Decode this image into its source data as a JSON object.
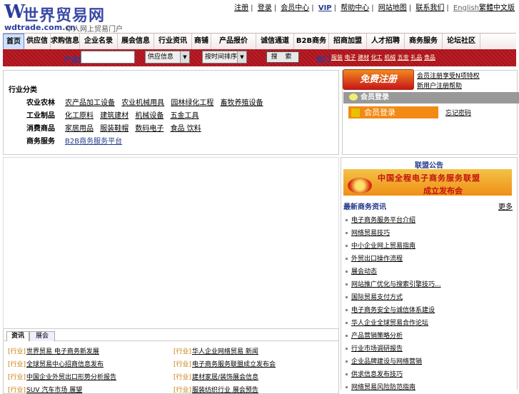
{
  "logo": {
    "mark": "W",
    "name": "世界贸易网",
    "url": "wdtrade.com.cn",
    "slogan": "华人网上贸易门户"
  },
  "toplinks": [
    "注册",
    "登录",
    "会员中心",
    "VIP",
    "帮助中心",
    "网站地图",
    "联系我们",
    "English",
    "繁體中文版"
  ],
  "nav": [
    "首页",
    "供应信息",
    "求购信息",
    "企业名录",
    "展会信息",
    "行业资讯",
    "商铺",
    "产品报价",
    "诚信通道",
    "B2B商务",
    "招商加盟",
    "人才招聘",
    "商务服务",
    "论坛社区"
  ],
  "search": {
    "label": "产品搜索",
    "value": "",
    "category": "供应信息",
    "sort": "按时间排序",
    "button": "搜 索",
    "hot_label": "热门",
    "hot_links": [
      "服装",
      "电子",
      "建材",
      "化工",
      "机械",
      "五金",
      "礼品",
      "食品"
    ]
  },
  "categories": {
    "title": "行业分类",
    "rows": [
      {
        "name": "农业农林",
        "links": [
          "农产品加工设备",
          "农业机械用具",
          "园林绿化工程",
          "畜牧养殖设备"
        ]
      },
      {
        "name": "工业制品",
        "links": [
          "化工原料",
          "建筑建材",
          "机械设备",
          "五金工具"
        ]
      },
      {
        "name": "消费商品",
        "links": [
          "家居用品",
          "服装鞋帽",
          "数码电子",
          "食品 饮料"
        ]
      },
      {
        "name": "商务服务",
        "links": [
          "B2B商务服务平台"
        ]
      }
    ]
  },
  "member": {
    "register": "免费注册",
    "link1": "会员注册享受N项特权",
    "link2": "新用户注册帮助",
    "login_bar": "会员登录",
    "login_btn": "会员登录",
    "help": "忘记密码"
  },
  "news": {
    "tabs": [
      "资讯",
      "展会"
    ],
    "items": [
      {
        "tag": "[行业]",
        "text": "世界贸易 电子商务新发展"
      },
      {
        "tag": "[行业]",
        "text": "全球贸易中心招商信息发布"
      },
      {
        "tag": "[行业]",
        "text": "中国企业外贸出口形势分析报告"
      },
      {
        "tag": "[行业]",
        "text": "SUV 汽车市场 展望"
      },
      {
        "tag": "[行业]",
        "text": "华人企业网络贸易 新闻"
      },
      {
        "tag": "[行业]",
        "text": "电子商务服务联盟成立发布会"
      },
      {
        "tag": "[行业]",
        "text": "建材家居/装饰展会信息"
      },
      {
        "tag": "[行业]",
        "text": "服装纺织行业 展会预告"
      }
    ]
  },
  "rightnews": {
    "header": "联盟公告",
    "banner_title": "中国全程电子商务服务联盟",
    "banner_sub": "成立发布会",
    "section": "最新商务资讯",
    "more": "更多",
    "items": [
      "电子商务服务平台介绍",
      "网络贸易技巧",
      "中小企业网上贸易指南",
      "外贸出口操作流程",
      "展会动态",
      "网站推广优化与搜索引擎技巧...",
      "国际贸易支付方式",
      "电子商务安全与诚信体系建设",
      "华人企业全球贸易合作论坛",
      "产品营销策略分析",
      "行业市场调研报告",
      "企业品牌建设与网络营销",
      "供求信息发布技巧",
      "网络贸易风险防范指南"
    ]
  }
}
